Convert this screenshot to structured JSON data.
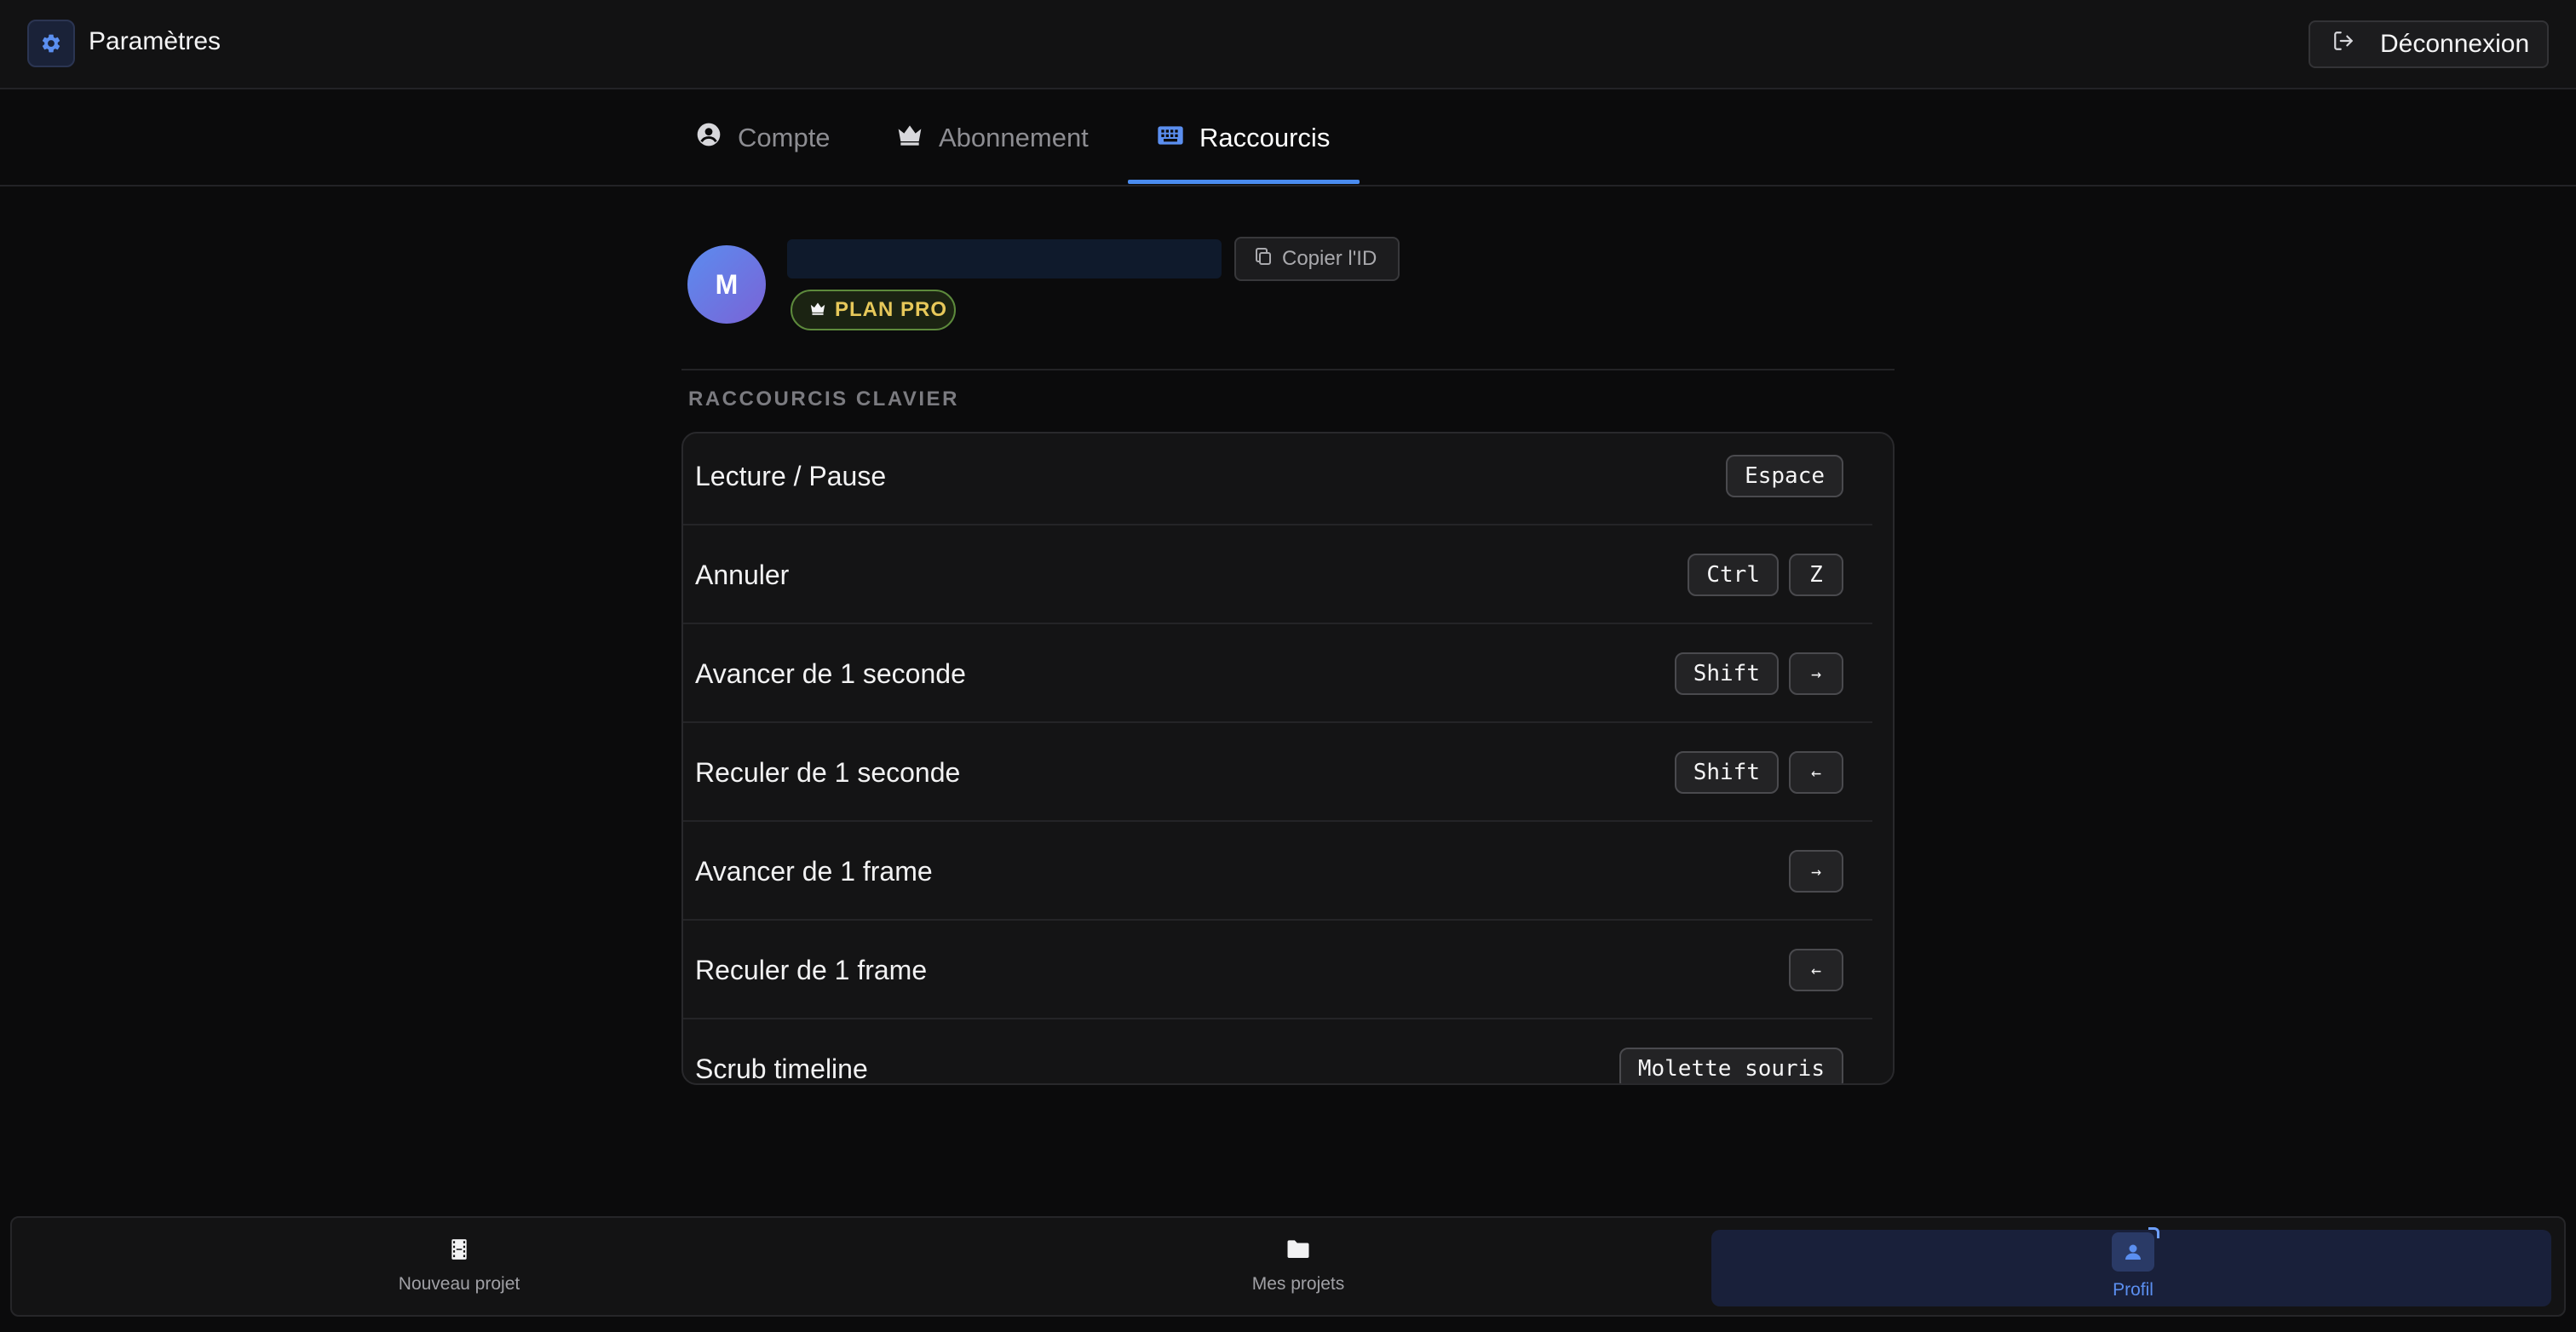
{
  "header": {
    "title": "Paramètres",
    "logout_label": "Déconnexion"
  },
  "tabs": [
    {
      "label": "Compte",
      "icon": "user-circle-icon",
      "active": false
    },
    {
      "label": "Abonnement",
      "icon": "crown-icon",
      "active": false
    },
    {
      "label": "Raccourcis",
      "icon": "keyboard-icon",
      "active": true
    }
  ],
  "profile": {
    "avatar_initial": "M",
    "copy_id_label": "Copier l'ID",
    "plan_label": "PLAN PRO"
  },
  "shortcuts": {
    "section_title": "RACCOURCIS CLAVIER",
    "items": [
      {
        "label": "Lecture / Pause",
        "keys": [
          "Espace"
        ]
      },
      {
        "label": "Annuler",
        "keys": [
          "Ctrl",
          "Z"
        ]
      },
      {
        "label": "Avancer de 1 seconde",
        "keys": [
          "Shift",
          "→"
        ]
      },
      {
        "label": "Reculer de 1 seconde",
        "keys": [
          "Shift",
          "←"
        ]
      },
      {
        "label": "Avancer de 1 frame",
        "keys": [
          "→"
        ]
      },
      {
        "label": "Reculer de 1 frame",
        "keys": [
          "←"
        ]
      },
      {
        "label": "Scrub timeline",
        "keys": [
          "Molette souris"
        ]
      }
    ]
  },
  "bottom_nav": [
    {
      "label": "Nouveau projet",
      "icon": "film-icon",
      "active": false
    },
    {
      "label": "Mes projets",
      "icon": "folder-icon",
      "active": false
    },
    {
      "label": "Profil",
      "icon": "user-icon",
      "active": true
    }
  ],
  "colors": {
    "accent": "#4a8cf0",
    "background": "#0b0b0c",
    "plan_badge_text": "#e7c85a",
    "plan_badge_border": "#5d8a3c"
  }
}
